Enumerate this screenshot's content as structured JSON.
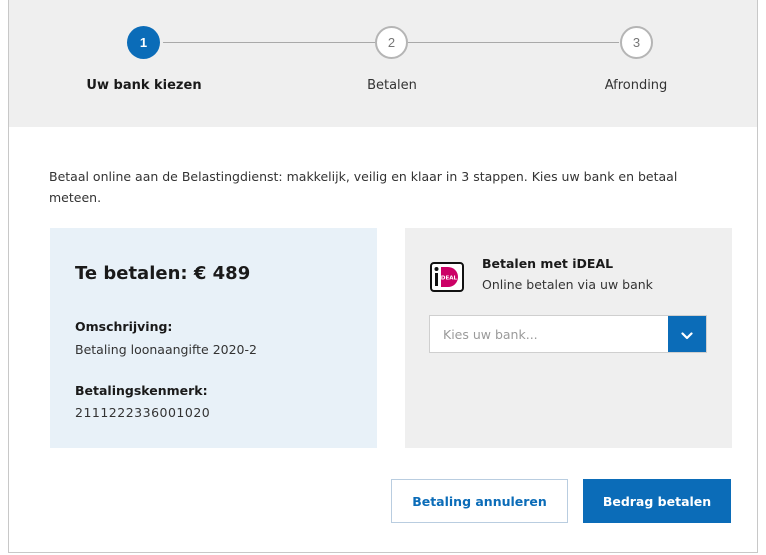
{
  "stepper": {
    "steps": [
      {
        "number": "1",
        "label": "Uw bank kiezen",
        "state": "active"
      },
      {
        "number": "2",
        "label": "Betalen",
        "state": "inactive"
      },
      {
        "number": "3",
        "label": "Afronding",
        "state": "inactive"
      }
    ]
  },
  "intro": "Betaal online aan de Belastingdienst: makkelijk, veilig en klaar in 3 stappen. Kies uw bank en betaal meteen.",
  "payment": {
    "amount_title": "Te betalen: € 489",
    "description_label": "Omschrijving:",
    "description_value": "Betaling loonaangifte 2020-2",
    "reference_label": "Betalingskenmerk:",
    "reference_value": "2111222336001020"
  },
  "ideal": {
    "logo_text": "iDEAL",
    "title": "Betalen met iDEAL",
    "subtitle": "Online betalen via uw bank",
    "select_placeholder": "Kies uw bank...",
    "chevron_icon": "chevron-down-icon"
  },
  "buttons": {
    "cancel_label": "Betaling annuleren",
    "pay_label": "Bedrag betalen"
  },
  "colors": {
    "primary": "#0b6cb8",
    "amount_bg": "#e8f1f8",
    "panel_bg": "#efefef",
    "ideal_pink": "#cc0066"
  }
}
